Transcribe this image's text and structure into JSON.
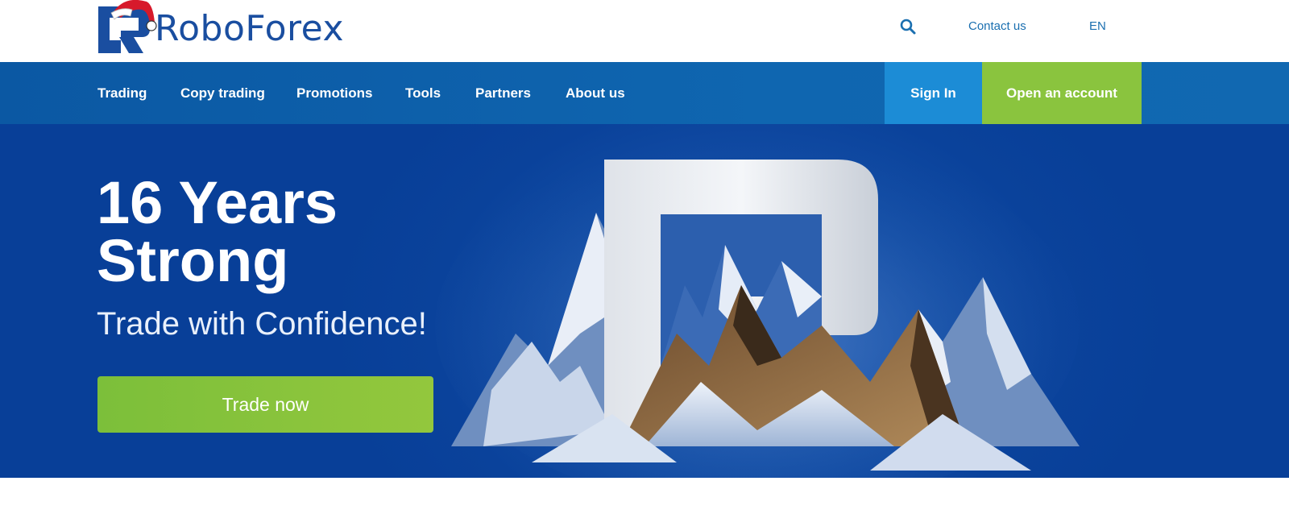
{
  "brand": {
    "name": "RoboForex",
    "color": "#1a4ea0",
    "hat_color": "#d7192b"
  },
  "header": {
    "search_icon": "search-icon",
    "contact_label": "Contact us",
    "language": "EN"
  },
  "nav": {
    "items": [
      {
        "label": "Trading"
      },
      {
        "label": "Copy trading"
      },
      {
        "label": "Promotions"
      },
      {
        "label": "Tools"
      },
      {
        "label": "Partners"
      },
      {
        "label": "About us"
      }
    ],
    "sign_in_label": "Sign In",
    "open_account_label": "Open an account"
  },
  "hero": {
    "title": "16 Years Strong",
    "subtitle": "Trade with Confidence!",
    "cta_label": "Trade now"
  },
  "colors": {
    "nav_bg": "#0f66b0",
    "sign_in_bg": "#1c8cd6",
    "accent_green": "#8ac43e",
    "hero_bg": "#0a429b"
  }
}
